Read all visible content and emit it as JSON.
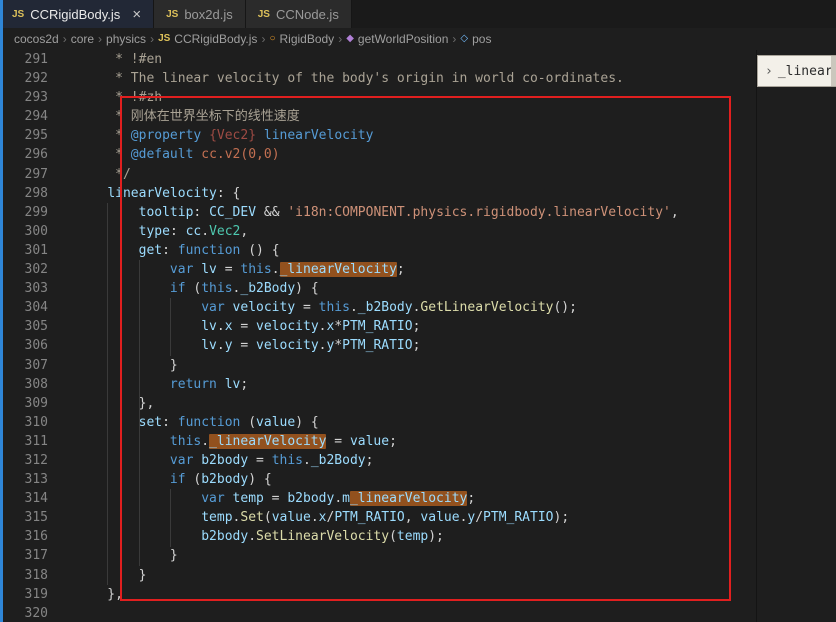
{
  "colors": {
    "editor_bg": "#1e1e1e",
    "left_edge_accent": "#2f86d7",
    "annotation_red": "#e11f1f",
    "word_highlight_bg": "#92511e",
    "keyword": "#569cd6",
    "identifier": "#9cdcfe",
    "function_name": "#dcdcaa",
    "string": "#ce9178",
    "comment": "#aaa395",
    "jsdoc_type": "#9e4b44",
    "class_type": "#4ec9b0",
    "line_number": "#858585"
  },
  "icons": {
    "js_badge": "JS",
    "close": "×",
    "crumb_sep": "›",
    "js-file": "JS",
    "symbol-class": "○",
    "symbol-method": "◆",
    "symbol-variable": "◇"
  },
  "tabs": [
    {
      "label": "CCRigidBody.js",
      "active": true
    },
    {
      "label": "box2d.js",
      "active": false
    },
    {
      "label": "CCNode.js",
      "active": false
    }
  ],
  "breadcrumb": [
    {
      "label": "cocos2d"
    },
    {
      "label": "core"
    },
    {
      "label": "physics"
    },
    {
      "label": "CCRigidBody.js",
      "icon": "js-file"
    },
    {
      "label": "RigidBody",
      "icon": "symbol-class"
    },
    {
      "label": "getWorldPosition",
      "icon": "symbol-method"
    },
    {
      "label": "pos",
      "icon": "symbol-variable"
    }
  ],
  "side_panel": {
    "chevron": "›",
    "label": "_linearVel"
  },
  "editor": {
    "lines": [
      {
        "n": 291,
        "t": [
          [
            "c",
            "     * !#en"
          ]
        ]
      },
      {
        "n": 292,
        "t": [
          [
            "c",
            "     * The linear velocity of the body's origin in world co-ordinates."
          ]
        ]
      },
      {
        "n": 293,
        "t": [
          [
            "c",
            "     * !#zh"
          ]
        ]
      },
      {
        "n": 294,
        "t": [
          [
            "c",
            "     * 刚体在世界坐标下的线性速度"
          ]
        ]
      },
      {
        "n": 295,
        "t": [
          [
            "c",
            "     * "
          ],
          [
            "tag",
            "@property"
          ],
          [
            "c",
            " "
          ],
          [
            "typ",
            "{Vec2}"
          ],
          [
            "c",
            " "
          ],
          [
            "jn",
            "linearVelocity"
          ]
        ]
      },
      {
        "n": 296,
        "t": [
          [
            "c",
            "     * "
          ],
          [
            "tag",
            "@default"
          ],
          [
            "c",
            " "
          ],
          [
            "jc",
            "cc.v2(0,0)"
          ]
        ]
      },
      {
        "n": 297,
        "t": [
          [
            "c",
            "     */"
          ]
        ]
      },
      {
        "n": 298,
        "t": [
          [
            "p",
            "    "
          ],
          [
            "v",
            "linearVelocity"
          ],
          [
            "p",
            ": {"
          ]
        ]
      },
      {
        "n": 299,
        "t": [
          [
            "p",
            "        "
          ],
          [
            "v",
            "tooltip"
          ],
          [
            "p",
            ": "
          ],
          [
            "v",
            "CC_DEV"
          ],
          [
            "p",
            " && "
          ],
          [
            "s",
            "'i18n:COMPONENT.physics.rigidbody.linearVelocity'"
          ],
          [
            "p",
            ","
          ]
        ]
      },
      {
        "n": 300,
        "t": [
          [
            "p",
            "        "
          ],
          [
            "v",
            "type"
          ],
          [
            "p",
            ": "
          ],
          [
            "v",
            "cc"
          ],
          [
            "p",
            "."
          ],
          [
            "cls",
            "Vec2"
          ],
          [
            "p",
            ","
          ]
        ]
      },
      {
        "n": 301,
        "t": [
          [
            "p",
            "        "
          ],
          [
            "v",
            "get"
          ],
          [
            "p",
            ": "
          ],
          [
            "k",
            "function"
          ],
          [
            "p",
            " () {"
          ]
        ]
      },
      {
        "n": 302,
        "t": [
          [
            "p",
            "            "
          ],
          [
            "k",
            "var"
          ],
          [
            "p",
            " "
          ],
          [
            "v",
            "lv"
          ],
          [
            "p",
            " = "
          ],
          [
            "k",
            "this"
          ],
          [
            "p",
            "."
          ],
          [
            "v",
            "_linearVelocity",
            1
          ],
          [
            "p",
            ";"
          ]
        ]
      },
      {
        "n": 303,
        "t": [
          [
            "p",
            "            "
          ],
          [
            "k",
            "if"
          ],
          [
            "p",
            " ("
          ],
          [
            "k",
            "this"
          ],
          [
            "p",
            "."
          ],
          [
            "v",
            "_b2Body"
          ],
          [
            "p",
            ") {"
          ]
        ]
      },
      {
        "n": 304,
        "t": [
          [
            "p",
            "                "
          ],
          [
            "k",
            "var"
          ],
          [
            "p",
            " "
          ],
          [
            "v",
            "velocity"
          ],
          [
            "p",
            " = "
          ],
          [
            "k",
            "this"
          ],
          [
            "p",
            "."
          ],
          [
            "v",
            "_b2Body"
          ],
          [
            "p",
            "."
          ],
          [
            "f",
            "GetLinearVelocity"
          ],
          [
            "p",
            "();"
          ]
        ]
      },
      {
        "n": 305,
        "t": [
          [
            "p",
            "                "
          ],
          [
            "v",
            "lv"
          ],
          [
            "p",
            "."
          ],
          [
            "v",
            "x"
          ],
          [
            "p",
            " = "
          ],
          [
            "v",
            "velocity"
          ],
          [
            "p",
            "."
          ],
          [
            "v",
            "x"
          ],
          [
            "p",
            "*"
          ],
          [
            "v",
            "PTM_RATIO"
          ],
          [
            "p",
            ";"
          ]
        ]
      },
      {
        "n": 306,
        "t": [
          [
            "p",
            "                "
          ],
          [
            "v",
            "lv"
          ],
          [
            "p",
            "."
          ],
          [
            "v",
            "y"
          ],
          [
            "p",
            " = "
          ],
          [
            "v",
            "velocity"
          ],
          [
            "p",
            "."
          ],
          [
            "v",
            "y"
          ],
          [
            "p",
            "*"
          ],
          [
            "v",
            "PTM_RATIO"
          ],
          [
            "p",
            ";"
          ]
        ]
      },
      {
        "n": 307,
        "t": [
          [
            "p",
            "            }"
          ]
        ]
      },
      {
        "n": 308,
        "t": [
          [
            "p",
            "            "
          ],
          [
            "k",
            "return"
          ],
          [
            "p",
            " "
          ],
          [
            "v",
            "lv"
          ],
          [
            "p",
            ";"
          ]
        ]
      },
      {
        "n": 309,
        "t": [
          [
            "p",
            "        },"
          ]
        ]
      },
      {
        "n": 310,
        "t": [
          [
            "p",
            "        "
          ],
          [
            "v",
            "set"
          ],
          [
            "p",
            ": "
          ],
          [
            "k",
            "function"
          ],
          [
            "p",
            " ("
          ],
          [
            "v",
            "value"
          ],
          [
            "p",
            ") {"
          ]
        ]
      },
      {
        "n": 311,
        "t": [
          [
            "p",
            "            "
          ],
          [
            "k",
            "this"
          ],
          [
            "p",
            "."
          ],
          [
            "v",
            "_linearVelocity",
            1
          ],
          [
            "p",
            " = "
          ],
          [
            "v",
            "value"
          ],
          [
            "p",
            ";"
          ]
        ]
      },
      {
        "n": 312,
        "t": [
          [
            "p",
            "            "
          ],
          [
            "k",
            "var"
          ],
          [
            "p",
            " "
          ],
          [
            "v",
            "b2body"
          ],
          [
            "p",
            " = "
          ],
          [
            "k",
            "this"
          ],
          [
            "p",
            "."
          ],
          [
            "v",
            "_b2Body"
          ],
          [
            "p",
            ";"
          ]
        ]
      },
      {
        "n": 313,
        "t": [
          [
            "p",
            "            "
          ],
          [
            "k",
            "if"
          ],
          [
            "p",
            " ("
          ],
          [
            "v",
            "b2body"
          ],
          [
            "p",
            ") {"
          ]
        ]
      },
      {
        "n": 314,
        "t": [
          [
            "p",
            "                "
          ],
          [
            "k",
            "var"
          ],
          [
            "p",
            " "
          ],
          [
            "v",
            "temp"
          ],
          [
            "p",
            " = "
          ],
          [
            "v",
            "b2body"
          ],
          [
            "p",
            "."
          ],
          [
            "v",
            "m"
          ],
          [
            "v",
            "_linearVelocity",
            1
          ],
          [
            "p",
            ";"
          ]
        ]
      },
      {
        "n": 315,
        "t": [
          [
            "p",
            "                "
          ],
          [
            "v",
            "temp"
          ],
          [
            "p",
            "."
          ],
          [
            "f",
            "Set"
          ],
          [
            "p",
            "("
          ],
          [
            "v",
            "value"
          ],
          [
            "p",
            "."
          ],
          [
            "v",
            "x"
          ],
          [
            "p",
            "/"
          ],
          [
            "v",
            "PTM_RATIO"
          ],
          [
            "p",
            ", "
          ],
          [
            "v",
            "value"
          ],
          [
            "p",
            "."
          ],
          [
            "v",
            "y"
          ],
          [
            "p",
            "/"
          ],
          [
            "v",
            "PTM_RATIO"
          ],
          [
            "p",
            ");"
          ]
        ]
      },
      {
        "n": 316,
        "t": [
          [
            "p",
            "                "
          ],
          [
            "v",
            "b2body"
          ],
          [
            "p",
            "."
          ],
          [
            "f",
            "SetLinearVelocity"
          ],
          [
            "p",
            "("
          ],
          [
            "v",
            "temp"
          ],
          [
            "p",
            ");"
          ]
        ]
      },
      {
        "n": 317,
        "t": [
          [
            "p",
            "            }"
          ]
        ]
      },
      {
        "n": 318,
        "t": [
          [
            "p",
            "        }"
          ]
        ]
      },
      {
        "n": 319,
        "t": [
          [
            "p",
            "    },"
          ]
        ]
      },
      {
        "n": 320,
        "t": []
      }
    ]
  }
}
